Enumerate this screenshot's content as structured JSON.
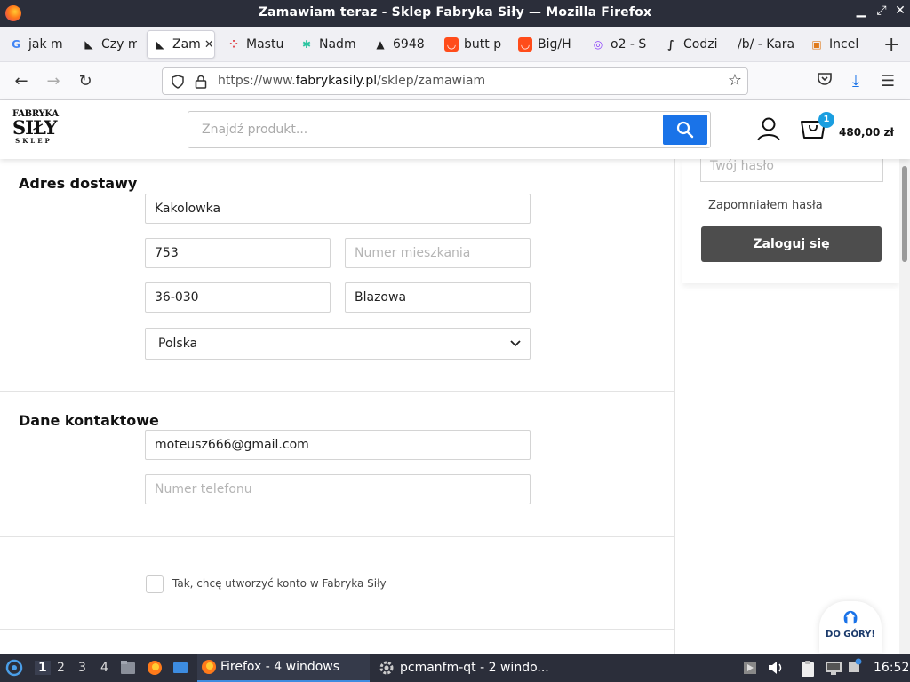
{
  "window": {
    "title": "Zamawiam teraz - Sklep Fabryka Siły — Mozilla Firefox"
  },
  "tabs": [
    {
      "label": "jak m",
      "icon": "google-icon"
    },
    {
      "label": "Czy m",
      "icon": "site-icon"
    },
    {
      "label": "Zam",
      "icon": "fabryka-icon",
      "active": true
    },
    {
      "label": "Mastu",
      "icon": "mastu-icon"
    },
    {
      "label": "Nadm",
      "icon": "nadm-icon"
    },
    {
      "label": "6948",
      "icon": "site-icon"
    },
    {
      "label": "butt p",
      "icon": "aliexpress-icon"
    },
    {
      "label": "Big/H",
      "icon": "aliexpress-icon"
    },
    {
      "label": "o2 - S",
      "icon": "o2-icon"
    },
    {
      "label": "Codzi",
      "icon": "site-icon"
    },
    {
      "label": "/b/ - Kara",
      "icon": ""
    },
    {
      "label": "Incel",
      "icon": "site-icon"
    }
  ],
  "navbar": {
    "url_prefix": "https://www.",
    "url_domain": "fabrykasily.pl",
    "url_path": "/sklep/zamawiam"
  },
  "site": {
    "logo": {
      "line1": "FABRYKA",
      "line2": "SIŁY",
      "line3": "SKLEP"
    },
    "search_placeholder": "Znajdź produkt...",
    "cart_count": "1",
    "cart_total": "480,00 zł"
  },
  "delivery": {
    "heading": "Adres dostawy",
    "street": "Kakolowka",
    "house_number": "753",
    "apartment_placeholder": "Numer mieszkania",
    "postal_code": "36-030",
    "city": "Blazowa",
    "country": "Polska"
  },
  "contact": {
    "heading": "Dane kontaktowe",
    "email": "moteusz666@gmail.com",
    "phone_placeholder": "Numer telefonu"
  },
  "account": {
    "create_label": "Tak, chcę utworzyć konto w Fabryka Siły"
  },
  "login": {
    "password_placeholder": "Twój hasło",
    "forgot": "Zapomniałem hasła",
    "button": "Zaloguj się"
  },
  "to_top": {
    "label": "DO GÓRY!"
  },
  "taskbar": {
    "workspaces": [
      "1",
      "2",
      "3",
      "4"
    ],
    "tasks": [
      {
        "label": "Firefox - 4 windows"
      },
      {
        "label": "pcmanfm-qt - 2 windo..."
      }
    ],
    "clock": "16:52"
  }
}
